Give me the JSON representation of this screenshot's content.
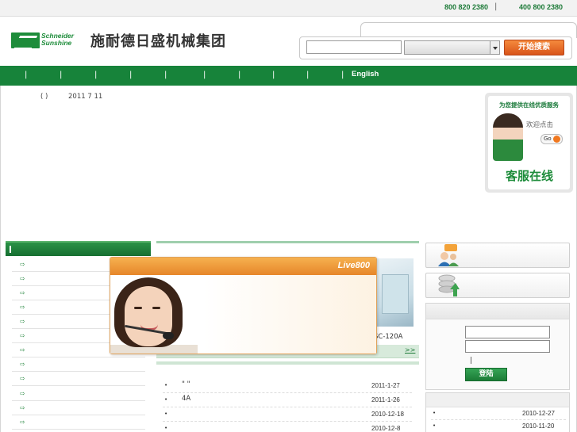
{
  "topbar": {
    "hotline1": "800 820 2380",
    "separator": "|",
    "hotline2": "400 800 2380"
  },
  "logo": {
    "brand_en_line1": "Schneider",
    "brand_en_line2": "Sunshine",
    "brand_cn": "施耐德日盛机械集团"
  },
  "search": {
    "input_value": "",
    "select_value": "",
    "button_label": "开始搜索"
  },
  "nav": {
    "separator": "|",
    "english_label": "English"
  },
  "info": {
    "paren": "( )",
    "date": "2011 7 11"
  },
  "service": {
    "header": "为您提供在线优质服务",
    "welcome": "欢迎点击",
    "go": "Go",
    "title": "客服在线"
  },
  "left": {
    "rows": 12
  },
  "product": {
    "label": "SC-120A",
    "more": ">>"
  },
  "news": [
    {
      "title": "\"    \"",
      "date": "2011-1-27"
    },
    {
      "title": "4A",
      "date": "2011-1-26"
    },
    {
      "title": "",
      "date": "2010-12-18"
    },
    {
      "title": "",
      "date": "2010-12-8"
    }
  ],
  "login": {
    "pipe": "|",
    "button_label": "登陆"
  },
  "news2": [
    {
      "date": "2010-12-27"
    },
    {
      "date": "2010-11-20"
    }
  ],
  "popup": {
    "title": "Live800"
  },
  "colors": {
    "brand_green": "#17833a",
    "accent_orange": "#e6862a"
  },
  "icons": [
    "shield-logo-icon",
    "dropdown-arrow-icon",
    "arrow-bullet-icon",
    "chat-people-icon",
    "upload-stack-icon"
  ]
}
